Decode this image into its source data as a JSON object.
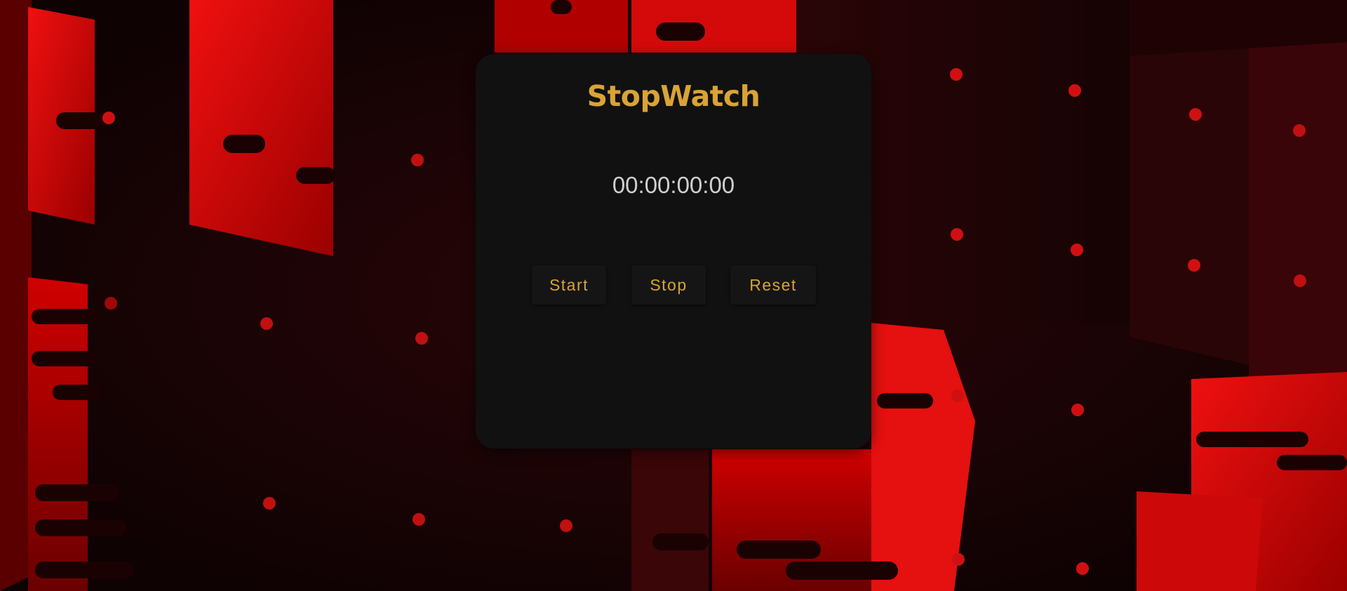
{
  "app": {
    "title": "StopWatch",
    "time_display": "00:00:00:00"
  },
  "controls": {
    "start_label": "Start",
    "stop_label": "Stop",
    "reset_label": "Reset"
  },
  "colors": {
    "accent": "#d9a336",
    "card_background": "#111111",
    "time_text": "#d0d0d0",
    "background_red": "#e00000"
  },
  "background": {
    "description_icon": "red-lockers-background"
  }
}
